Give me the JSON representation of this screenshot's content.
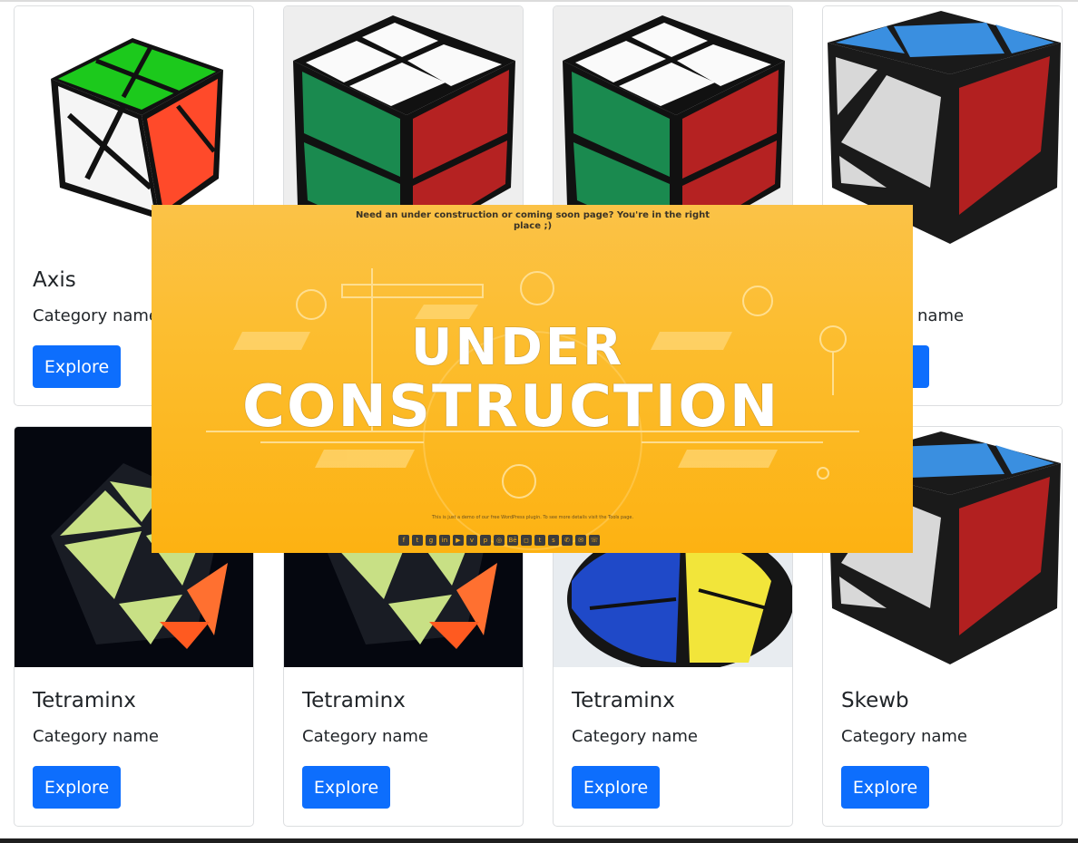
{
  "cards": [
    {
      "title": "Axis",
      "category": "Category name",
      "button": "Explore",
      "image_icon": "axis-cube-image"
    },
    {
      "title": "",
      "category": "",
      "button": "",
      "image_icon": "2x2-cube-image"
    },
    {
      "title": "",
      "category": "",
      "button": "",
      "image_icon": "2x2-cube-image"
    },
    {
      "title": "",
      "category": "name",
      "button": "",
      "image_icon": "skewb-image"
    },
    {
      "title": "Tetraminx",
      "category": "Category name",
      "button": "Explore",
      "image_icon": "tetraminx-image"
    },
    {
      "title": "Tetraminx",
      "category": "Category name",
      "button": "Explore",
      "image_icon": "tetraminx-image"
    },
    {
      "title": "Tetraminx",
      "category": "Category name",
      "button": "Explore",
      "image_icon": "pyraminx-ball-image"
    },
    {
      "title": "Skewb",
      "category": "Category name",
      "button": "Explore",
      "image_icon": "skewb-image"
    }
  ],
  "overlay": {
    "headline": "Need an under construction or coming soon page? You're in the right place ;)",
    "word_top": "UNDER",
    "word_bottom": "CONSTRUCTION",
    "note": "This is just a demo of our free WordPress plugin. To see more details visit the Tools page.",
    "social_icons": [
      "facebook-icon",
      "twitter-icon",
      "google-plus-icon",
      "linkedin-icon",
      "youtube-icon",
      "vimeo-icon",
      "pinterest-icon",
      "dribbble-icon",
      "behance-icon",
      "instagram-icon",
      "tumblr-icon",
      "skype-icon",
      "whatsapp-icon",
      "email-icon",
      "phone-icon"
    ],
    "social_glyphs": [
      "f",
      "t",
      "g",
      "in",
      "▶",
      "v",
      "p",
      "◎",
      "Bē",
      "◻",
      "t",
      "s",
      "✆",
      "✉",
      "☏"
    ]
  },
  "colors": {
    "button": "#0d6efd",
    "overlay": "#fdb212"
  }
}
